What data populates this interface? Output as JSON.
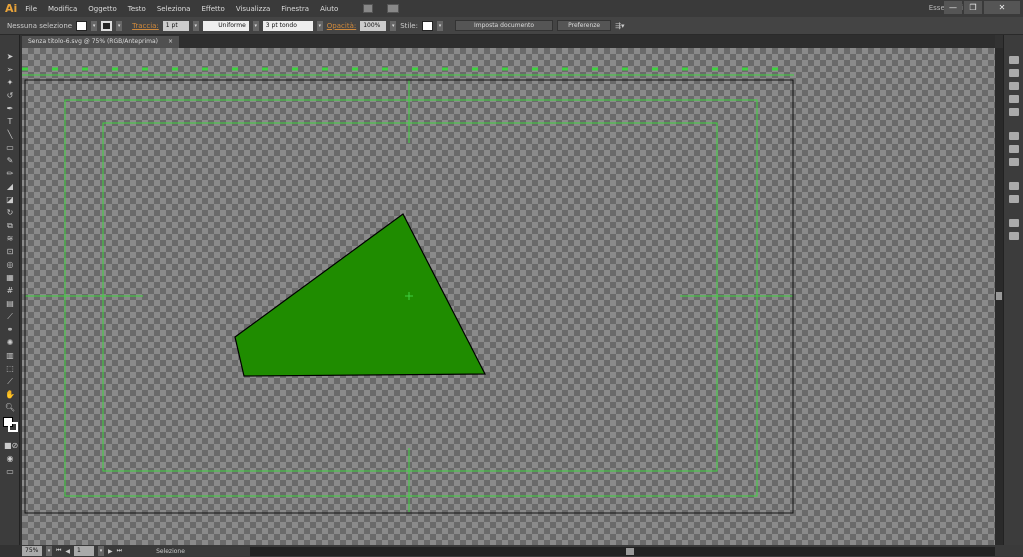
{
  "app": {
    "logo": "Ai",
    "menus": [
      "File",
      "Modifica",
      "Oggetto",
      "Testo",
      "Seleziona",
      "Effetto",
      "Visualizza",
      "Finestra",
      "Aiuto"
    ],
    "workspace": "Essenziali",
    "window_buttons": [
      "—",
      "❐",
      "✕"
    ]
  },
  "control": {
    "selection": "Nessuna selezione",
    "stroke_label": "Traccia:",
    "stroke_weight": "1 pt",
    "stroke_style": "Uniforme",
    "brush": "3 pt tondo",
    "opacity_label": "Opacità:",
    "opacity": "100%",
    "style_label": "Stile:",
    "document_setup": "Imposta documento",
    "preferences": "Preferenze"
  },
  "document": {
    "tab_title": "Senza titolo-6.svg @ 75% (RGB/Anteprima)",
    "tab_close": "×",
    "shape_fill": "#1f8c00",
    "guide_color": "#3fd13f"
  },
  "status": {
    "zoom": "75%",
    "artboard": "1",
    "tool": "Selezione"
  }
}
